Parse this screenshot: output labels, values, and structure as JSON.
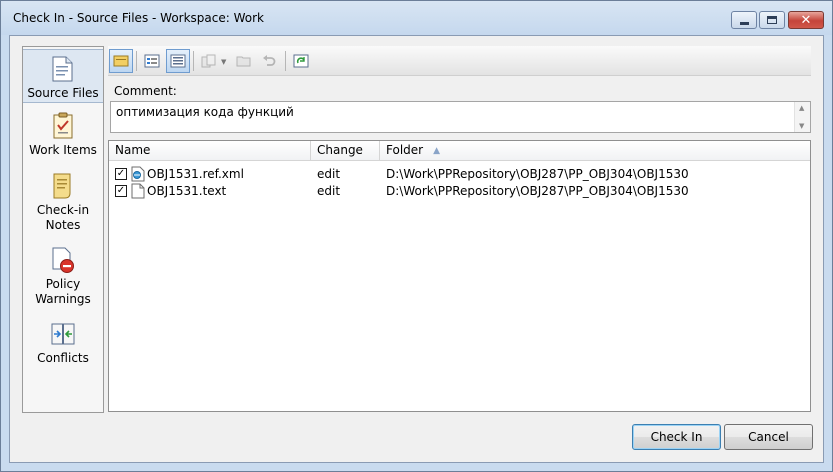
{
  "window": {
    "title": "Check In - Source Files - Workspace: Work",
    "controls": [
      "minimize",
      "maximize",
      "close"
    ]
  },
  "nav": {
    "items": [
      {
        "id": "source-files",
        "line1": "Source Files",
        "line2": "",
        "icon": "source-files-icon",
        "selected": true
      },
      {
        "id": "work-items",
        "line1": "Work Items",
        "line2": "",
        "icon": "work-items-icon",
        "selected": false
      },
      {
        "id": "checkin-notes",
        "line1": "Check-in",
        "line2": "Notes",
        "icon": "checkin-notes-icon",
        "selected": false
      },
      {
        "id": "policy-warnings",
        "line1": "Policy",
        "line2": "Warnings",
        "icon": "policy-warnings-icon",
        "selected": false
      },
      {
        "id": "conflicts",
        "line1": "Conflicts",
        "line2": "",
        "icon": "conflicts-icon",
        "selected": false
      }
    ]
  },
  "toolbar": {
    "buttons": [
      {
        "icon": "comment-toggle-icon",
        "active": true
      },
      {
        "icon": "flat-view-icon",
        "active": false
      },
      {
        "icon": "folder-view-icon",
        "active": true
      },
      {
        "icon": "compare-icon",
        "active": false,
        "disabled": true
      },
      {
        "icon": "open-folder-icon",
        "active": false,
        "disabled": true
      },
      {
        "icon": "undo-icon",
        "active": false,
        "disabled": true
      },
      {
        "icon": "refresh-icon",
        "active": false
      }
    ]
  },
  "comment": {
    "label": "Comment:",
    "value": "оптимизация кода функций"
  },
  "file_list": {
    "columns": [
      "Name",
      "Change",
      "Folder"
    ],
    "sorted_column": "Folder",
    "sort_direction": "ascending",
    "rows": [
      {
        "checked": true,
        "name": "OBJ1531.ref.xml",
        "change": "edit",
        "folder": "D:\\Work\\PPRepository\\OBJ287\\PP_OBJ304\\OBJ1530",
        "file_icon": "xml-file-icon"
      },
      {
        "checked": true,
        "name": "OBJ1531.text",
        "change": "edit",
        "folder": "D:\\Work\\PPRepository\\OBJ287\\PP_OBJ304\\OBJ1530",
        "file_icon": "text-file-icon"
      }
    ]
  },
  "buttons": {
    "check_in": "Check In",
    "cancel": "Cancel"
  },
  "colors": {
    "window_frame": "#c9dbef",
    "client_background": "#f0f0f0",
    "selected_nav": "#dde7f2",
    "default_button_border": "#3c7fb1"
  }
}
